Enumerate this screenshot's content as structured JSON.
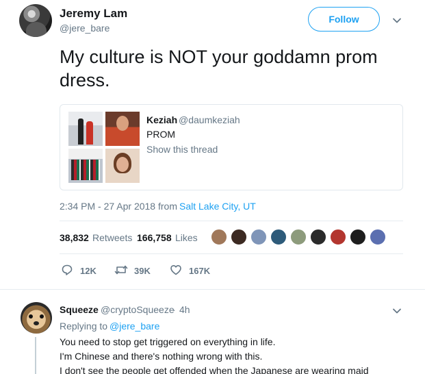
{
  "tweet": {
    "author_name": "Jeremy Lam",
    "author_handle": "@jere_bare",
    "follow_label": "Follow",
    "text": "My culture is NOT your goddamn prom dress.",
    "quoted": {
      "name": "Keziah",
      "handle": "@daumkeziah",
      "text": "PROM",
      "thread_link": "Show this thread"
    },
    "timestamp": "2:34 PM - 27 Apr 2018 from",
    "location": "Salt Lake City, UT",
    "stats": {
      "retweets_count": "38,832",
      "retweets_label": "Retweets",
      "likes_count": "166,758",
      "likes_label": "Likes"
    },
    "liker_colors": [
      "#a0785a",
      "#3c2a22",
      "#7f95b8",
      "#2e5b7a",
      "#8d9b7c",
      "#2b2b2b",
      "#b3362f",
      "#1e1e1e",
      "#5b6fb0"
    ],
    "actions": {
      "replies": "12K",
      "retweets": "39K",
      "likes": "167K"
    }
  },
  "reply": {
    "name": "Squeeze",
    "handle": "@cryptoSqueeze",
    "separator": "·",
    "time": "4h",
    "replying_prefix": "Replying to",
    "replying_to": "@jere_bare",
    "lines": [
      "You need to stop get triggered on everything in life.",
      "I'm Chinese and there's nothing wrong with this.",
      "I don't see the people get offended when the Japanese are wearing maid"
    ]
  },
  "colors": {
    "accent": "#1da1f2",
    "secondary_text": "#657786",
    "primary_text": "#14171a",
    "border": "#e1e8ed"
  }
}
